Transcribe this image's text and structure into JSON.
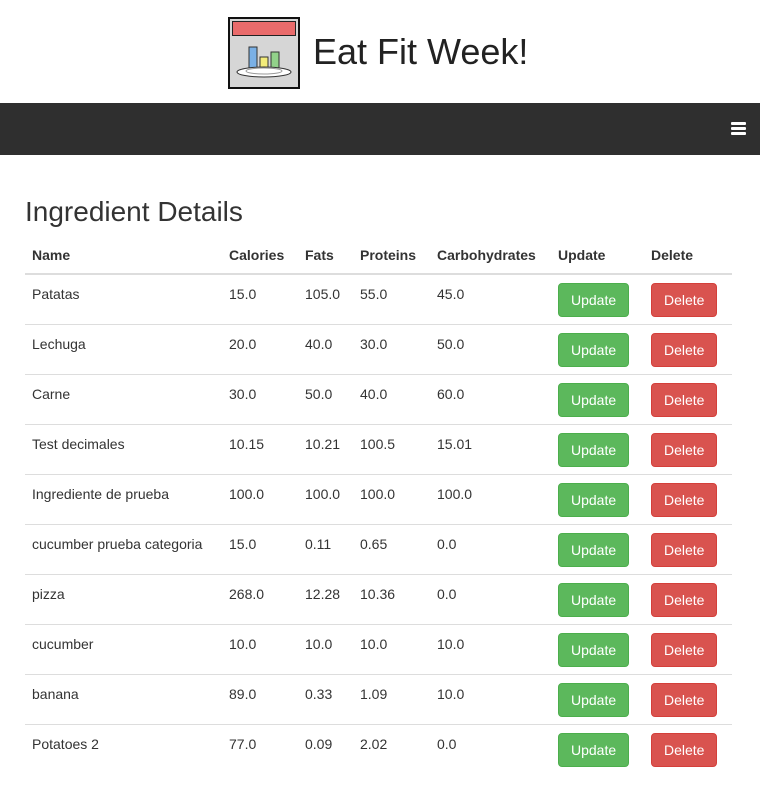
{
  "app": {
    "title": "Eat Fit Week!"
  },
  "navbar": {
    "menu_icon": "hamburger-menu-icon"
  },
  "page": {
    "heading": "Ingredient Details"
  },
  "table": {
    "columns": [
      "Name",
      "Calories",
      "Fats",
      "Proteins",
      "Carbohydrates",
      "Update",
      "Delete"
    ],
    "update_label": "Update",
    "delete_label": "Delete",
    "rows": [
      {
        "name": "Patatas",
        "calories": "15.0",
        "fats": "105.0",
        "proteins": "55.0",
        "carbohydrates": "45.0"
      },
      {
        "name": "Lechuga",
        "calories": "20.0",
        "fats": "40.0",
        "proteins": "30.0",
        "carbohydrates": "50.0"
      },
      {
        "name": "Carne",
        "calories": "30.0",
        "fats": "50.0",
        "proteins": "40.0",
        "carbohydrates": "60.0"
      },
      {
        "name": "Test decimales",
        "calories": "10.15",
        "fats": "10.21",
        "proteins": "100.5",
        "carbohydrates": "15.01"
      },
      {
        "name": "Ingrediente de prueba",
        "calories": "100.0",
        "fats": "100.0",
        "proteins": "100.0",
        "carbohydrates": "100.0"
      },
      {
        "name": "cucumber prueba categoria",
        "calories": "15.0",
        "fats": "0.11",
        "proteins": "0.65",
        "carbohydrates": "0.0"
      },
      {
        "name": "pizza",
        "calories": "268.0",
        "fats": "12.28",
        "proteins": "10.36",
        "carbohydrates": "0.0"
      },
      {
        "name": "cucumber",
        "calories": "10.0",
        "fats": "10.0",
        "proteins": "10.0",
        "carbohydrates": "10.0"
      },
      {
        "name": "banana",
        "calories": "89.0",
        "fats": "0.33",
        "proteins": "1.09",
        "carbohydrates": "10.0"
      },
      {
        "name": "Potatoes 2",
        "calories": "77.0",
        "fats": "0.09",
        "proteins": "2.02",
        "carbohydrates": "0.0"
      }
    ]
  },
  "colors": {
    "navbar": "#2f2f2f",
    "update_button": "#5cb85c",
    "delete_button": "#d9534f",
    "logo_top": "#e96b6b"
  }
}
